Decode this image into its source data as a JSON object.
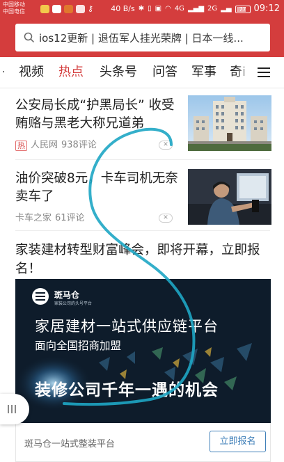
{
  "status_bar": {
    "carrier_line1": "中国移动",
    "carrier_line2": "中国电信",
    "speed": "40 B/s",
    "net1": "4G",
    "net2": "2G",
    "battery": "77",
    "time": "09:12"
  },
  "search": {
    "icon": "search-icon",
    "text": "ios12更新 | 退伍军人挂光荣牌 | 日本一线..."
  },
  "tabs": [
    {
      "label": "视频"
    },
    {
      "label": "热点",
      "active": true
    },
    {
      "label": "头条号"
    },
    {
      "label": "问答"
    },
    {
      "label": "军事"
    },
    {
      "label": "奇i"
    }
  ],
  "news": [
    {
      "title_line1": "公安局长成“护黑局长” 收受",
      "title_line2": "贿赂与黑老大称兄道弟",
      "badge": "热",
      "source": "人民网",
      "comments": "938评论"
    },
    {
      "title_line1": "油价突破8元，卡车司机无奈",
      "title_line2": "卖车了",
      "source": "卡车之家",
      "comments": "61评论"
    }
  ],
  "ad": {
    "title": "家装建材转型财富峰会，即将开幕，立即报名！",
    "logo_text": "斑马仓",
    "logo_sub": "家装公司的头号平台",
    "headline1": "家居建材一站式供应链平台",
    "headline2": "面向全国招商加盟",
    "headline3": "装修公司千年一遇的机会",
    "brand": "斑马仓一站式整装平台",
    "cta": "立即报名"
  },
  "colors": {
    "accent": "#d43d3d",
    "cta": "#3f7fb8",
    "banner_bg": "#0e1c2b",
    "gesture_trail": "#1ea6c4"
  }
}
